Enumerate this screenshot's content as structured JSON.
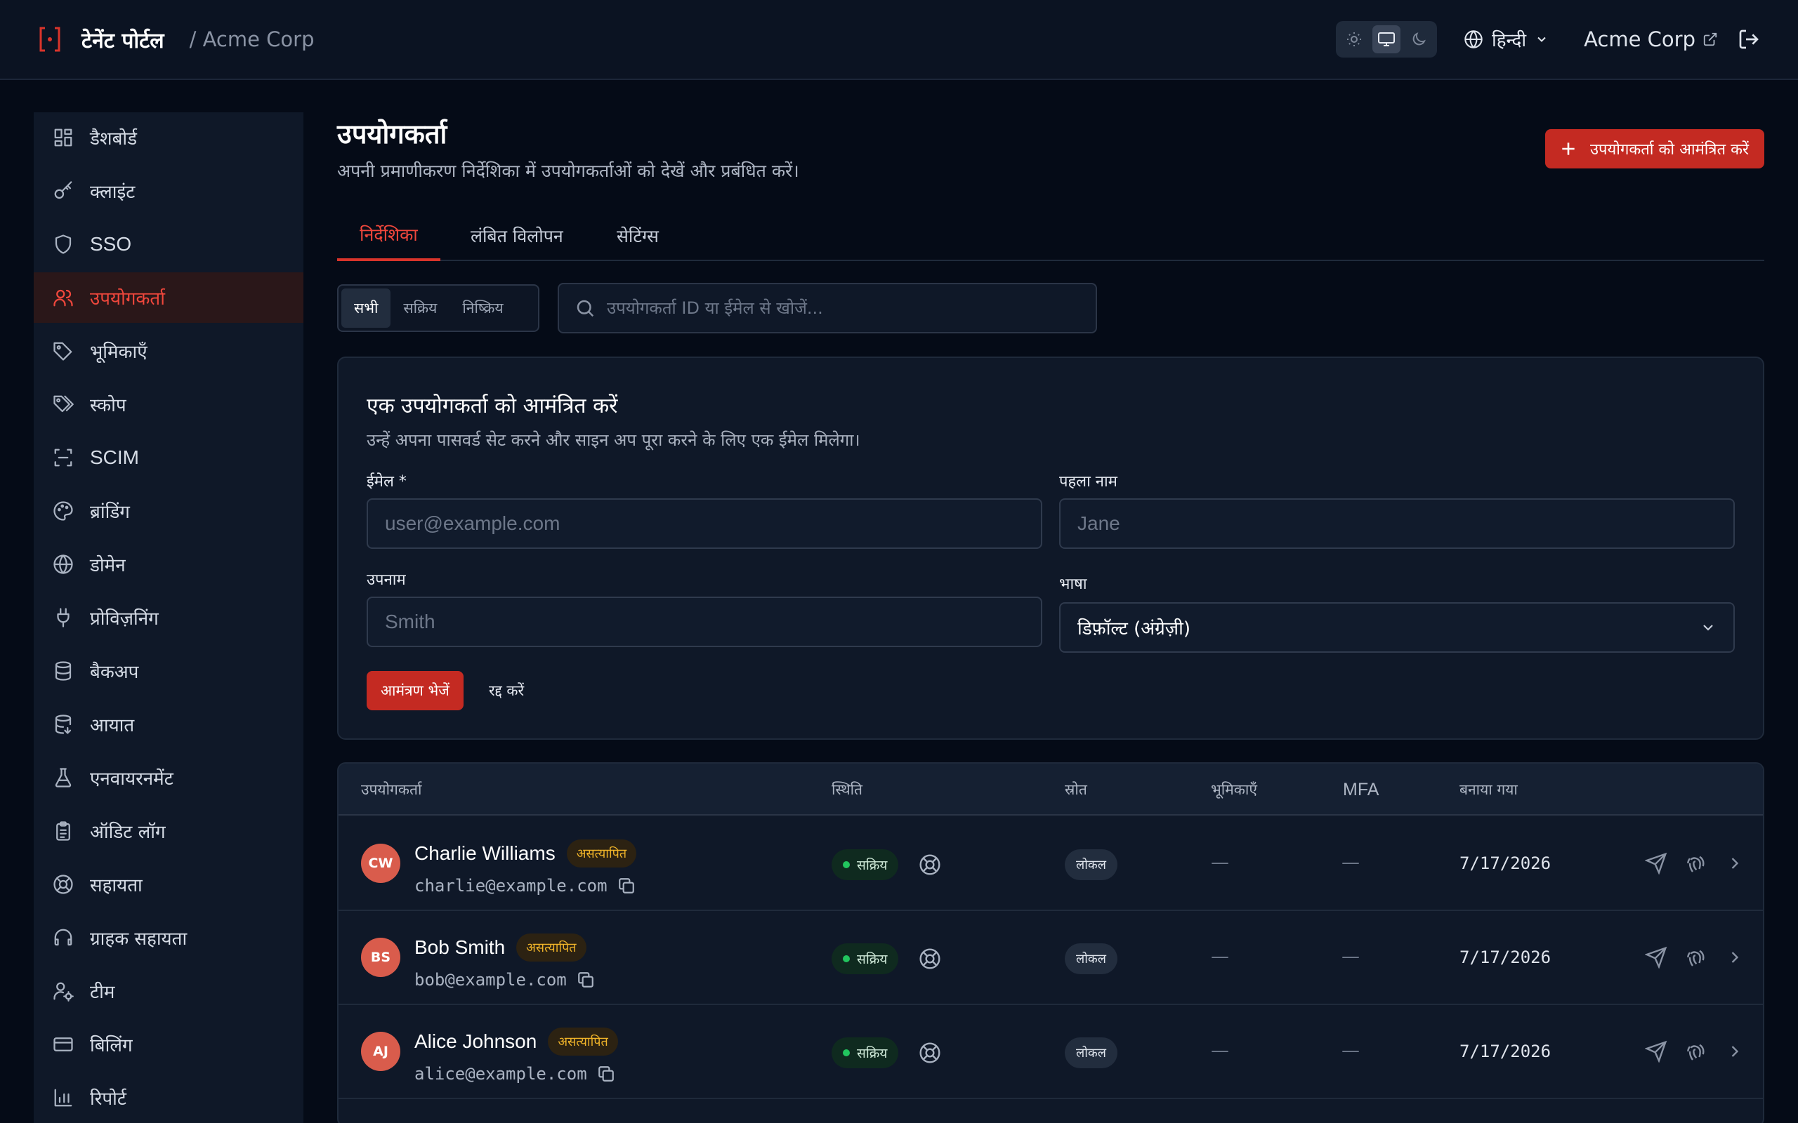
{
  "topbar": {
    "logo_glyph": "[·]",
    "title": "टेनेंट पोर्टल",
    "org_path": "/ Acme Corp",
    "language": "हिन्दी",
    "org_name": "Acme Corp",
    "theme_options": [
      "sun-icon",
      "monitor-icon",
      "moon-icon"
    ],
    "active_theme": "monitor-icon"
  },
  "sidebar": {
    "items": [
      {
        "label": "डैशबोर्ड",
        "icon": "dashboard-icon"
      },
      {
        "label": "क्लाइंट",
        "icon": "key-icon"
      },
      {
        "label": "SSO",
        "icon": "shield-icon"
      },
      {
        "label": "उपयोगकर्ता",
        "icon": "users-icon",
        "active": true
      },
      {
        "label": "भूमिकाएँ",
        "icon": "tag-icon"
      },
      {
        "label": "स्कोप",
        "icon": "tags-icon"
      },
      {
        "label": "SCIM",
        "icon": "scan-icon"
      },
      {
        "label": "ब्रांडिंग",
        "icon": "palette-icon"
      },
      {
        "label": "डोमेन",
        "icon": "globe-icon"
      },
      {
        "label": "प्रोविज़निंग",
        "icon": "plug-icon"
      },
      {
        "label": "बैकअप",
        "icon": "database-icon"
      },
      {
        "label": "आयात",
        "icon": "database-import-icon"
      },
      {
        "label": "एनवायरनमेंट",
        "icon": "flask-icon"
      },
      {
        "label": "ऑडिट लॉग",
        "icon": "clipboard-icon"
      },
      {
        "label": "सहायता",
        "icon": "lifebuoy-icon"
      },
      {
        "label": "ग्राहक सहायता",
        "icon": "headset-icon"
      },
      {
        "label": "टीम",
        "icon": "user-cog-icon"
      },
      {
        "label": "बिलिंग",
        "icon": "credit-card-icon"
      },
      {
        "label": "रिपोर्ट",
        "icon": "chart-icon"
      }
    ]
  },
  "page": {
    "title": "उपयोगकर्ता",
    "subtitle": "अपनी प्रमाणीकरण निर्देशिका में उपयोगकर्ताओं को देखें और प्रबंधित करें।",
    "invite_button": "उपयोगकर्ता को आमंत्रित करें"
  },
  "tabs": [
    "निर्देशिका",
    "लंबित विलोपन",
    "सेटिंग्स"
  ],
  "active_tab": "निर्देशिका",
  "filters": {
    "options": [
      "सभी",
      "सक्रिय",
      "निष्क्रिय"
    ],
    "active": "सभी",
    "search_placeholder": "उपयोगकर्ता ID या ईमेल से खोजें..."
  },
  "invite_form": {
    "title": "एक उपयोगकर्ता को आमंत्रित करें",
    "subtitle": "उन्हें अपना पासवर्ड सेट करने और साइन अप पूरा करने के लिए एक ईमेल मिलेगा।",
    "email_label": "ईमेल *",
    "email_placeholder": "user@example.com",
    "first_name_label": "पहला नाम",
    "first_name_placeholder": "Jane",
    "last_name_label": "उपनाम",
    "last_name_placeholder": "Smith",
    "language_label": "भाषा",
    "language_value": "डिफ़ॉल्ट (अंग्रेज़ी)",
    "send_button": "आमंत्रण भेजें",
    "cancel_button": "रद्द करें"
  },
  "table": {
    "columns": [
      "उपयोगकर्ता",
      "स्थिति",
      "स्रोत",
      "भूमिकाएँ",
      "MFA",
      "बनाया गया"
    ],
    "rows": [
      {
        "initials": "CW",
        "name": "Charlie Williams",
        "badge": "असत्यापित",
        "email": "charlie@example.com",
        "status": "सक्रिय",
        "source": "लोकल",
        "roles": "—",
        "mfa": "—",
        "created": "7/17/2026"
      },
      {
        "initials": "BS",
        "name": "Bob Smith",
        "badge": "असत्यापित",
        "email": "bob@example.com",
        "status": "सक्रिय",
        "source": "लोकल",
        "roles": "—",
        "mfa": "—",
        "created": "7/17/2026"
      },
      {
        "initials": "AJ",
        "name": "Alice Johnson",
        "badge": "असत्यापित",
        "email": "alice@example.com",
        "status": "सक्रिय",
        "source": "लोकल",
        "roles": "—",
        "mfa": "—",
        "created": "7/17/2026"
      }
    ]
  },
  "colors": {
    "accent": "#d9342b",
    "background": "#050b17",
    "surface": "#0f1828",
    "status_active": "#22c55e",
    "badge_unverified": "#f0b429"
  }
}
